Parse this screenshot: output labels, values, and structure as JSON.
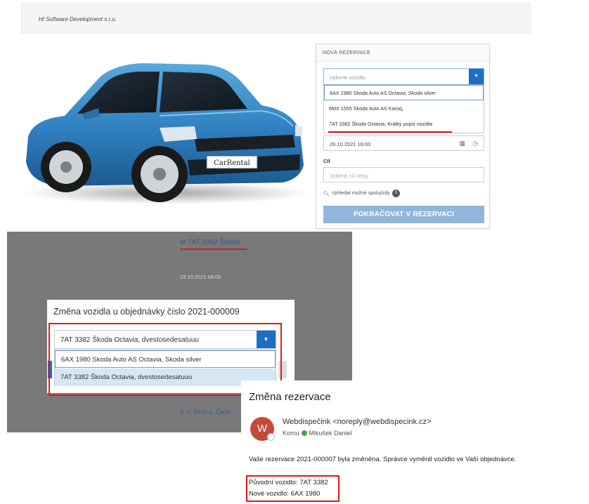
{
  "header": {
    "company": "HI Software Development s.r.o."
  },
  "car": {
    "plate_text": "CarRental"
  },
  "reservation_panel": {
    "title": "NOVÁ REZERVACE",
    "vehicle_placeholder": "Vyberte vozidlo",
    "vehicle_options": [
      "6AX 1980 Skoda Auto AS Octavia, Skoda silver",
      "6MX 1555 Skoda Auto AS Karoq,",
      "7AT 3382 Škoda Octavia, Krátký popis vozidla"
    ],
    "date_value": "26.10.2021 16:00",
    "destination_label": "Cíl",
    "destination_placeholder": "Vyberte cíl cesty",
    "search_link": "Vyhledat možné spolujízdy",
    "search_count": "0",
    "continue_button": "POKRAČOVAT V REZERVACI"
  },
  "order_view": {
    "vehicle": "7AT 3382 Škoda",
    "date": "23.10.2021 08:00",
    "location": "0, Praha, Česk"
  },
  "change_modal": {
    "title": "Změna vozidla u objednávky číslo 2021-000009",
    "selected_value": "7AT 3382 Škoda Octavia, dvestosedesatuuu",
    "options": [
      "6AX 1980 Skoda Auto AS Octavia, Skoda silver",
      "7AT 3382 Škoda Octavia, dvestosedesatuuu"
    ]
  },
  "email": {
    "subject": "Změna rezervace",
    "avatar_letter": "W",
    "sender": "Webdispečink <noreply@webdispecink.cz>",
    "recipient_prefix": "Komu",
    "recipient_name": "Mikušek Daniel",
    "body": "Vaše rezervace 2021-000007 byla změněna. Správce vyměnil vozidlo ve Vaší objednávce.",
    "original_vehicle": "Původní vozidlo: 7AT 3382",
    "new_vehicle": "Nové vozidlo: 6AX 1980"
  },
  "colors": {
    "accent_blue": "#1c6fc4",
    "button_disabled": "#91b6db",
    "highlight_red": "#e31919",
    "car_body": "#3f8fc8"
  }
}
